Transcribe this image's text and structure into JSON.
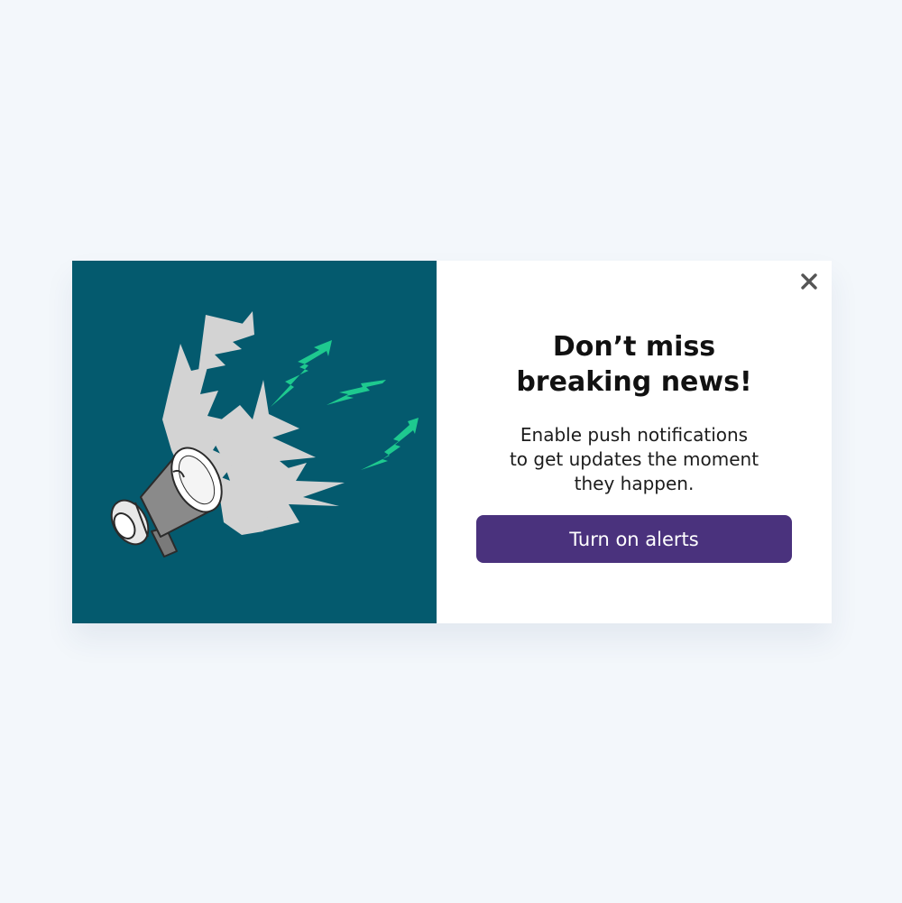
{
  "popup": {
    "headline_line1": "Don’t miss",
    "headline_line2": "breaking news!",
    "body_line1": "Enable push notifications",
    "body_line2": "to get updates the moment",
    "body_line3": "they happen.",
    "cta_label": "Turn on alerts",
    "close_icon": "close-icon",
    "illustration": "megaphone-with-lightning-bolts"
  },
  "colors": {
    "page_background": "#f3f7fb",
    "illustration_background": "#045a6e",
    "bolt_accent": "#1ec98f",
    "cta_background": "#4a327d",
    "cta_text": "#ffffff",
    "close_icon": "#555555"
  }
}
